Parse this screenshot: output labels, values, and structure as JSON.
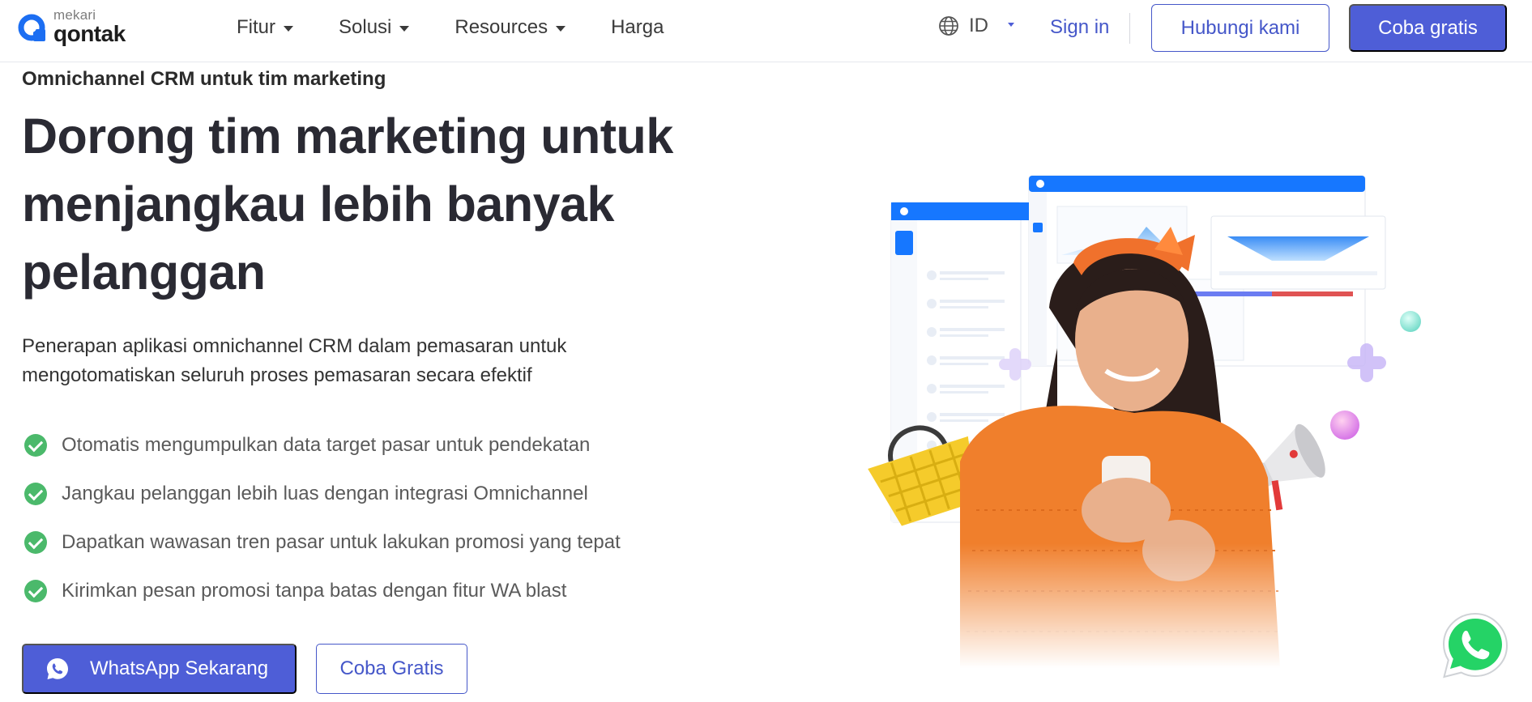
{
  "brand": {
    "top": "mekari",
    "name": "qontak"
  },
  "nav": {
    "items": [
      {
        "label": "Fitur",
        "dropdown": true
      },
      {
        "label": "Solusi",
        "dropdown": true
      },
      {
        "label": "Resources",
        "dropdown": true
      },
      {
        "label": "Harga",
        "dropdown": false
      }
    ],
    "language": "ID",
    "sign_in": "Sign in",
    "contact_button": "Hubungi kami",
    "trial_button": "Coba gratis"
  },
  "hero": {
    "eyebrow": "Omnichannel CRM untuk tim marketing",
    "title": "Dorong tim marketing untuk menjangkau lebih banyak pelanggan",
    "description": "Penerapan aplikasi omnichannel CRM dalam pemasaran untuk mengotomatiskan seluruh proses pemasaran secara efektif",
    "features": [
      "Otomatis mengumpulkan data target pasar untuk pendekatan",
      "Jangkau pelanggan lebih luas dengan integrasi Omnichannel",
      "Dapatkan wawasan tren pasar untuk lakukan promosi yang tepat",
      "Kirimkan pesan promosi tanpa batas dengan fitur WA blast"
    ],
    "whatsapp_button": "WhatsApp Sekarang",
    "trial_button": "Coba Gratis"
  },
  "colors": {
    "primary": "#4e5ed7",
    "link": "#4557c9",
    "check": "#4bb96b",
    "whatsapp": "#25d366",
    "dashboard_header": "#1677ff",
    "sweater": "#f07f2c"
  },
  "icons": {
    "logo": "qontak-logo-icon",
    "globe": "globe-icon",
    "check": "check-circle-icon",
    "whatsapp": "whatsapp-icon"
  }
}
